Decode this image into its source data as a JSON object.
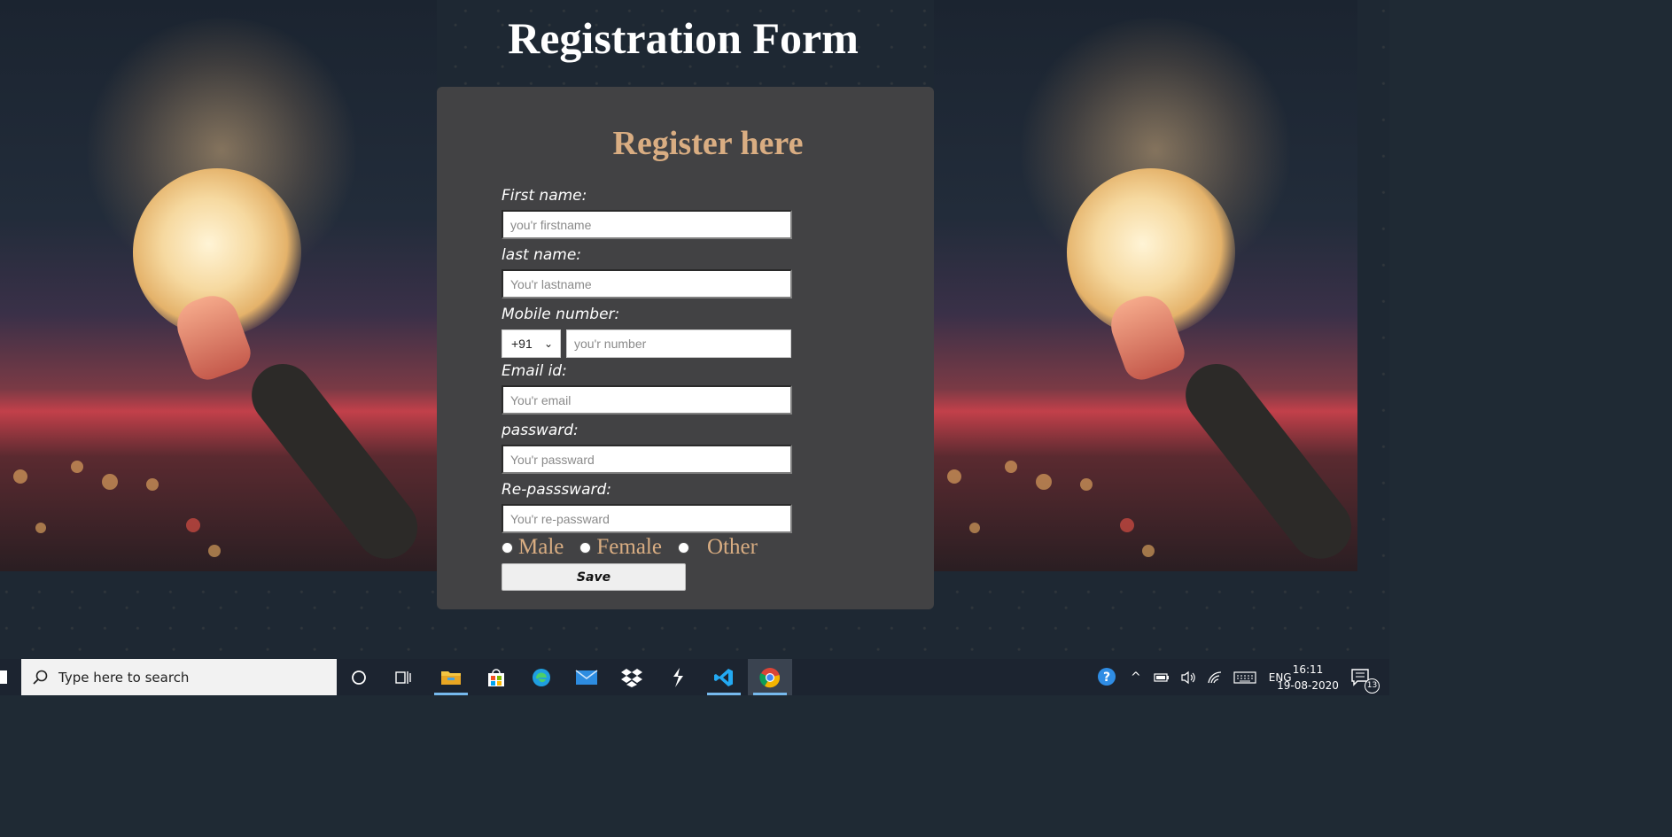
{
  "page": {
    "title": "Registration Form"
  },
  "form": {
    "heading": "Register here",
    "first_name": {
      "label": "First name:",
      "placeholder": "you'r firstname"
    },
    "last_name": {
      "label": "last name:",
      "placeholder": "You'r lastname"
    },
    "mobile": {
      "label": "Mobile number:",
      "country_code": "+91",
      "placeholder": "you'r number"
    },
    "email": {
      "label": "Email id:",
      "placeholder": "You'r email"
    },
    "password": {
      "label": "passward:",
      "placeholder": "You'r passward"
    },
    "repassword": {
      "label": "Re-passsward:",
      "placeholder": "You'r re-passward"
    },
    "gender": {
      "options": [
        "Male",
        "Female",
        "Other"
      ]
    },
    "save_label": "Save"
  },
  "taskbar": {
    "search_placeholder": "Type here to search",
    "apps": [
      "cortana-circle",
      "task-view",
      "file-explorer",
      "microsoft-store",
      "edge",
      "mail",
      "dropbox",
      "sublime",
      "vscode",
      "chrome"
    ],
    "language": "ENG",
    "time": "16:11",
    "date": "19-08-2020",
    "notification_count": "13"
  },
  "colors": {
    "card": "#424244",
    "heading": "#d9ad82",
    "taskbar": "#1c2430",
    "active_indicator": "#76b9ed"
  }
}
